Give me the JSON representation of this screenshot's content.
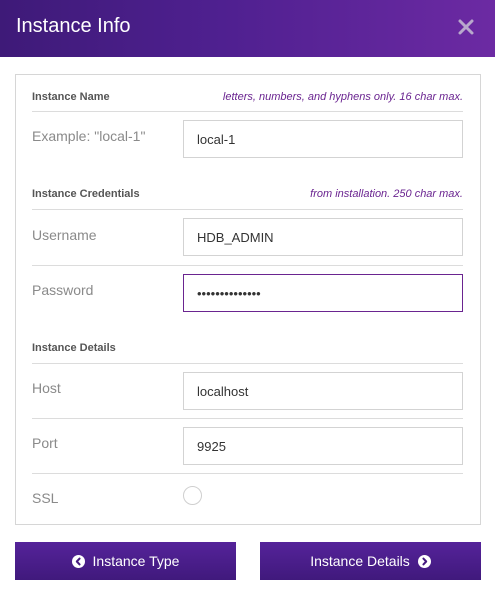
{
  "dialog": {
    "title": "Instance Info",
    "close_icon": "close-icon"
  },
  "sections": {
    "name": {
      "title": "Instance Name",
      "hint": "letters, numbers, and hyphens only. 16 char max.",
      "field_label": "Example: \"local-1\"",
      "value": "local-1"
    },
    "credentials": {
      "title": "Instance Credentials",
      "hint": "from installation. 250 char max.",
      "username_label": "Username",
      "username_value": "HDB_ADMIN",
      "password_label": "Password",
      "password_value": "••••••••••••••"
    },
    "details": {
      "title": "Instance Details",
      "host_label": "Host",
      "host_value": "localhost",
      "port_label": "Port",
      "port_value": "9925",
      "ssl_label": "SSL",
      "ssl_checked": false
    }
  },
  "footer": {
    "back_label": "Instance Type",
    "back_icon": "circle-chevron-left-icon",
    "next_label": "Instance Details",
    "next_icon": "circle-chevron-right-icon"
  },
  "colors": {
    "header_start": "#3e1a78",
    "header_end": "#6c2aa3",
    "accent": "#6a2490",
    "button": "#4a1e8c"
  }
}
